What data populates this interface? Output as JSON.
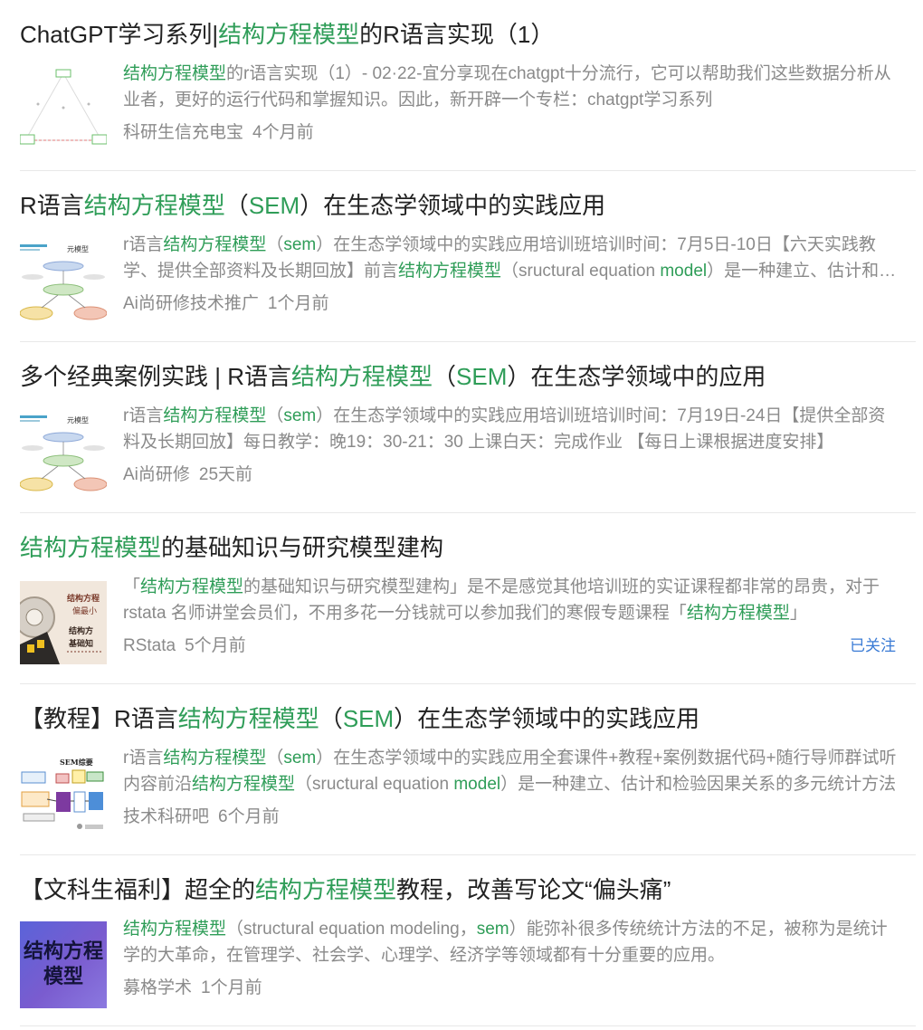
{
  "results": [
    {
      "title": [
        {
          "t": "ChatGPT学习系列|",
          "h": false
        },
        {
          "t": "结构方程模型",
          "h": true
        },
        {
          "t": "的R语言实现（1）",
          "h": false
        }
      ],
      "snippet": [
        {
          "t": "结构方程模型",
          "h": true
        },
        {
          "t": "的r语言实现（1）- 02·22-宜分享现在chatgpt十分流行，它可以帮助我们这些数据分析从业者，更好的运行代码和掌握知识。因此，新开辟一个专栏：chatgpt学习系列",
          "h": false
        }
      ],
      "source": "科研生信充电宝",
      "time": "4个月前",
      "thumb_icon": "sem-path-diagram-thumbnail"
    },
    {
      "title": [
        {
          "t": "R语言",
          "h": false
        },
        {
          "t": "结构方程模型",
          "h": true
        },
        {
          "t": "（",
          "h": false
        },
        {
          "t": "SEM",
          "h": true
        },
        {
          "t": "）在生态学领域中的实践应用",
          "h": false
        }
      ],
      "snippet": [
        {
          "t": "r语言",
          "h": false
        },
        {
          "t": "结构方程模型",
          "h": true
        },
        {
          "t": "（",
          "h": false
        },
        {
          "t": "sem",
          "h": true
        },
        {
          "t": "）在生态学领域中的实践应用培训班培训时间：7月5日-10日【六天实践教学、提供全部资料及长期回放】前言",
          "h": false
        },
        {
          "t": "结构方程模型",
          "h": true
        },
        {
          "t": "（sructural equation ",
          "h": false
        },
        {
          "t": "model",
          "h": true
        },
        {
          "t": "）是一种建立、估计和检验因果关系的多元统计方法",
          "h": false
        }
      ],
      "source": "Ai尚研修技术推广",
      "time": "1个月前",
      "thumb_icon": "sem-ecology-diagram-thumbnail",
      "thumb_label": "元模型"
    },
    {
      "title": [
        {
          "t": "多个经典案例实践 | R语言",
          "h": false
        },
        {
          "t": "结构方程模型",
          "h": true
        },
        {
          "t": "（",
          "h": false
        },
        {
          "t": "SEM",
          "h": true
        },
        {
          "t": "）在生态学领域中的应用",
          "h": false
        }
      ],
      "snippet": [
        {
          "t": "r语言",
          "h": false
        },
        {
          "t": "结构方程模型",
          "h": true
        },
        {
          "t": "（",
          "h": false
        },
        {
          "t": "sem",
          "h": true
        },
        {
          "t": "）在生态学领域中的实践应用培训班培训时间：7月19日-24日【提供全部资料及长期回放】每日教学：晚19：30-21：30 上课白天：完成作业 【每日上课根据进度安排】",
          "h": false
        }
      ],
      "source": "Ai尚研修",
      "time": "25天前",
      "thumb_icon": "sem-ecology-diagram-thumbnail",
      "thumb_label": "元模型"
    },
    {
      "title": [
        {
          "t": "结构方程模型",
          "h": true
        },
        {
          "t": "的基础知识与研究模型建构",
          "h": false
        }
      ],
      "snippet": [
        {
          "t": "「",
          "h": false
        },
        {
          "t": "结构方程模型",
          "h": true
        },
        {
          "t": "的基础知识与研究模型建构」是不是感觉其他培训班的实证课程都非常的昂贵，对于 rstata 名师讲堂会员们，不用多花一分钱就可以参加我们的寒假专题课程「",
          "h": false
        },
        {
          "t": "结构方程模型",
          "h": true
        },
        {
          "t": "」",
          "h": false
        }
      ],
      "source": "RStata",
      "time": "5个月前",
      "follow_label": "已关注",
      "thumb_icon": "film-reel-thumbnail",
      "thumb_text": [
        "结构方程",
        "偏最小",
        "结构方",
        "基础知"
      ]
    },
    {
      "title": [
        {
          "t": "【教程】R语言",
          "h": false
        },
        {
          "t": "结构方程模型",
          "h": true
        },
        {
          "t": "（",
          "h": false
        },
        {
          "t": "SEM",
          "h": true
        },
        {
          "t": "）在生态学领域中的实践应用",
          "h": false
        }
      ],
      "snippet": [
        {
          "t": "r语言",
          "h": false
        },
        {
          "t": "结构方程模型",
          "h": true
        },
        {
          "t": "（",
          "h": false
        },
        {
          "t": "sem",
          "h": true
        },
        {
          "t": "）在生态学领域中的实践应用全套课件+教程+案例数据代码+随行导师群试听内容前沿",
          "h": false
        },
        {
          "t": "结构方程模型",
          "h": true
        },
        {
          "t": "（sructural equation ",
          "h": false
        },
        {
          "t": "model",
          "h": true
        },
        {
          "t": "）是一种建立、估计和检验因果关系的多元统计方法",
          "h": false
        }
      ],
      "source": "技术科研吧",
      "time": "6个月前",
      "thumb_icon": "sem-overview-diagram-thumbnail",
      "thumb_label": "SEM综要"
    },
    {
      "title": [
        {
          "t": "【文科生福利】超全的",
          "h": false
        },
        {
          "t": "结构方程模型",
          "h": true
        },
        {
          "t": "教程，改善写论文“偏头痛”",
          "h": false
        }
      ],
      "snippet": [
        {
          "t": "结构方程模型",
          "h": true
        },
        {
          "t": "（structural equation modeling，",
          "h": false
        },
        {
          "t": "sem",
          "h": true
        },
        {
          "t": "）能弥补很多传统统计方法的不足，被称为是统计学的大革命，在管理学、社会学、心理学、经济学等领域都有十分重要的应用。",
          "h": false
        }
      ],
      "source": "募格学术",
      "time": "1个月前",
      "thumb_icon": "purple-title-card-thumbnail",
      "thumb_text": [
        "结构方程",
        "模型"
      ]
    }
  ]
}
